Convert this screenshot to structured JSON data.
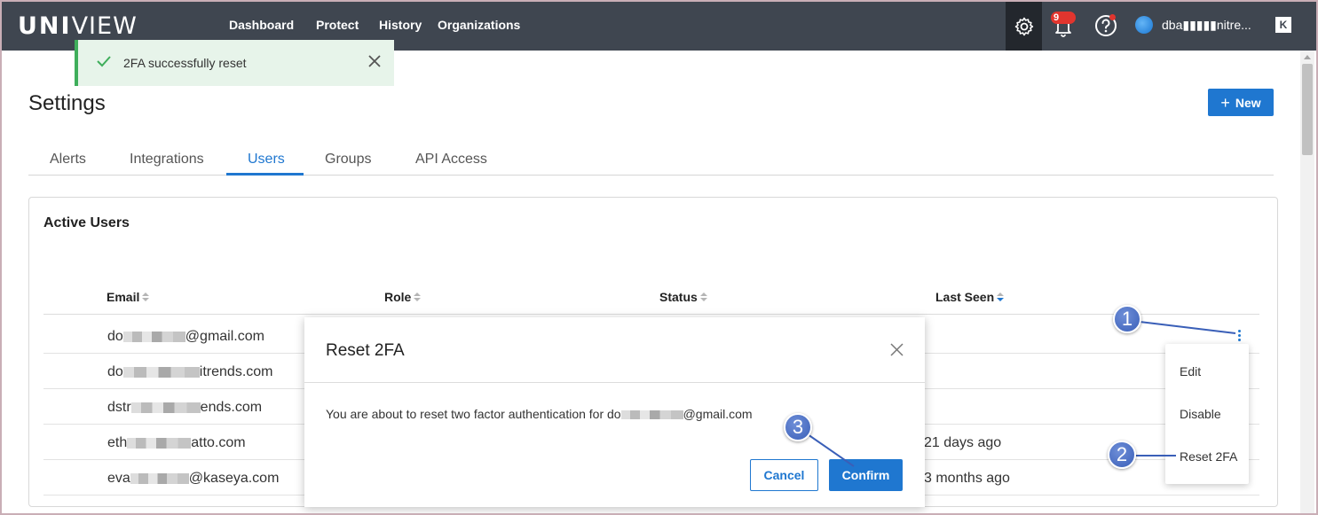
{
  "app": {
    "logo_bold": "UNI",
    "logo_light": "VIEW",
    "nav": [
      "Dashboard",
      "Protect",
      "History",
      "Organizations"
    ],
    "notification_count": "9",
    "user_name": "dba▮▮▮▮▮nitre...",
    "user_menu_glyph": "K"
  },
  "toast": {
    "message": "2FA successfully reset"
  },
  "page": {
    "title": "Settings",
    "new_button": "New",
    "tabs": [
      "Alerts",
      "Integrations",
      "Users",
      "Groups",
      "API Access"
    ],
    "active_tab": "Users"
  },
  "table": {
    "title": "Active Users",
    "columns": [
      "Email",
      "Role",
      "Status",
      "Last Seen"
    ],
    "rows": [
      {
        "email_start": "do",
        "email_end": "@gmail.com",
        "last_seen": ""
      },
      {
        "email_start": "do",
        "email_end": "itrends.com",
        "last_seen": ""
      },
      {
        "email_start": "dstr",
        "email_end": "ends.com",
        "last_seen": ""
      },
      {
        "email_start": "eth",
        "email_end": "atto.com",
        "last_seen": "21 days ago"
      },
      {
        "email_start": "eva",
        "email_end": "@kaseya.com",
        "last_seen": "3 months ago"
      }
    ]
  },
  "row_menu": {
    "items": [
      "Edit",
      "Disable",
      "Reset 2FA"
    ]
  },
  "modal": {
    "title": "Reset 2FA",
    "body_prefix": "You are about to reset two factor authentication for do",
    "body_suffix": "@gmail.com",
    "cancel_label": "Cancel",
    "confirm_label": "Confirm"
  },
  "callouts": [
    "1",
    "2",
    "3"
  ],
  "colors": {
    "primary": "#1f77d0",
    "topbar": "#3f4650",
    "success": "#3fae5b",
    "alert": "#e1352e",
    "callout": "#3a5fb8"
  }
}
